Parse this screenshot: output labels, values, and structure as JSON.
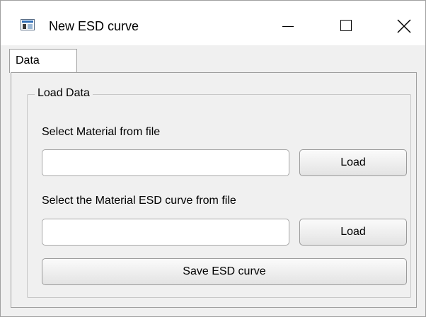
{
  "window": {
    "title": "New ESD curve",
    "icon": "app-window-icon",
    "controls": {
      "minimize": "minimize-icon",
      "maximize": "maximize-icon",
      "close": "close-icon"
    }
  },
  "tabs": [
    {
      "label": "Data",
      "selected": true
    }
  ],
  "load_group": {
    "title": "Load Data",
    "material_label": "Select Material from file",
    "material_input": {
      "value": "",
      "placeholder": ""
    },
    "material_load_button": "Load",
    "esd_label": "Select the Material ESD curve from file",
    "esd_input": {
      "value": "",
      "placeholder": ""
    },
    "esd_load_button": "Load",
    "save_button": "Save ESD curve"
  }
}
